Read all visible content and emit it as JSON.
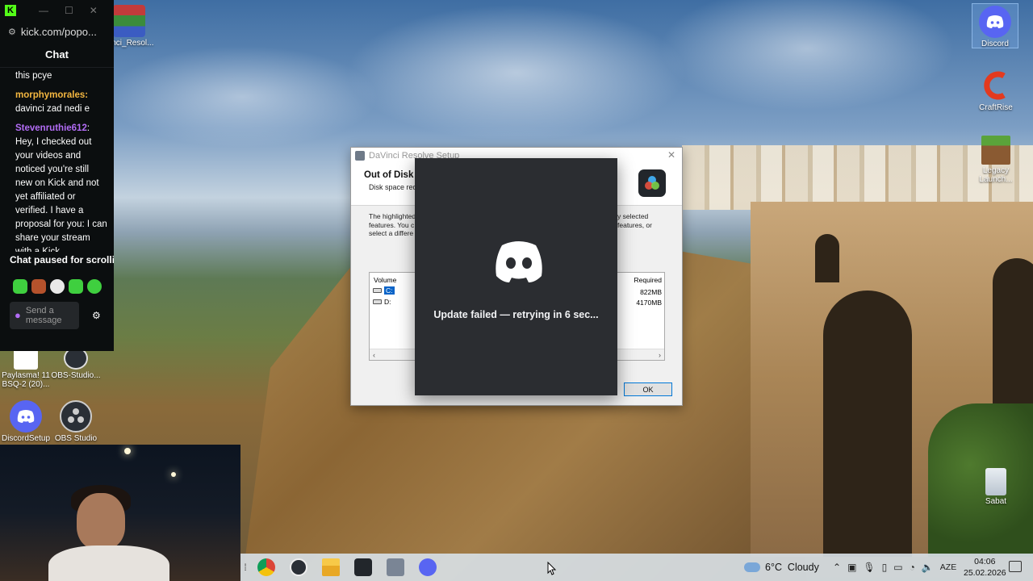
{
  "desktop": {
    "icons_left": [
      {
        "label": "Vinci_Resol..."
      },
      {
        "label": "Paylasma! 11 BSQ-2 (20)..."
      },
      {
        "label": "OBS-Studio..."
      },
      {
        "label": "DiscordSetup"
      },
      {
        "label": "OBS Studio"
      }
    ],
    "icons_right": [
      {
        "label": "Discord"
      },
      {
        "label": "CraftRise"
      },
      {
        "label": "Legacy Launch..."
      },
      {
        "label": "Sabat"
      }
    ]
  },
  "chat_window": {
    "url": "kick.com/popo...",
    "header": "Chat",
    "messages": [
      {
        "user": "",
        "text": "this pcye"
      },
      {
        "user": "morphymorales",
        "text": "davinci zad nedi e"
      },
      {
        "user": "Stevenruthie612",
        "text": "Hey, I checked out your videos and noticed you're still new on Kick and not yet affiliated or verified. I have a proposal for you: I can share your stream with a Kick"
      }
    ],
    "paused_label": "Chat paused for scrollin",
    "input_placeholder": "Send a message",
    "colors": {
      "username_yellow": "#f4b740",
      "username_purple": "#b26cf5",
      "kick_green": "#53fc18"
    }
  },
  "davinci_dialog": {
    "title": "DaVinci Resolve Setup",
    "heading": "Out of Disk S",
    "subheading": "Disk space requ",
    "body_left": [
      "The highlighted",
      "features. You c",
      "select a differe"
    ],
    "body_right": [
      "y selected",
      "features, or"
    ],
    "table": {
      "col_volume": "Volume",
      "col_required": "Required",
      "rows": [
        {
          "volume": "C:",
          "required": "822MB",
          "selected": true
        },
        {
          "volume": "D:",
          "required": "4170MB",
          "selected": false
        }
      ]
    },
    "ok_label": "OK"
  },
  "discord_updater": {
    "status": "Update failed — retrying in 6 sec...",
    "brand_color": "#5865f2"
  },
  "taskbar": {
    "weather": "6°C  Cloudy",
    "language": "AZE",
    "time": "04:06",
    "date": "25.02.2026",
    "apps": [
      "chrome-icon",
      "obs-icon",
      "file-explorer-icon",
      "davinci-resolve-icon",
      "davinci-setup-icon",
      "discord-icon"
    ]
  }
}
